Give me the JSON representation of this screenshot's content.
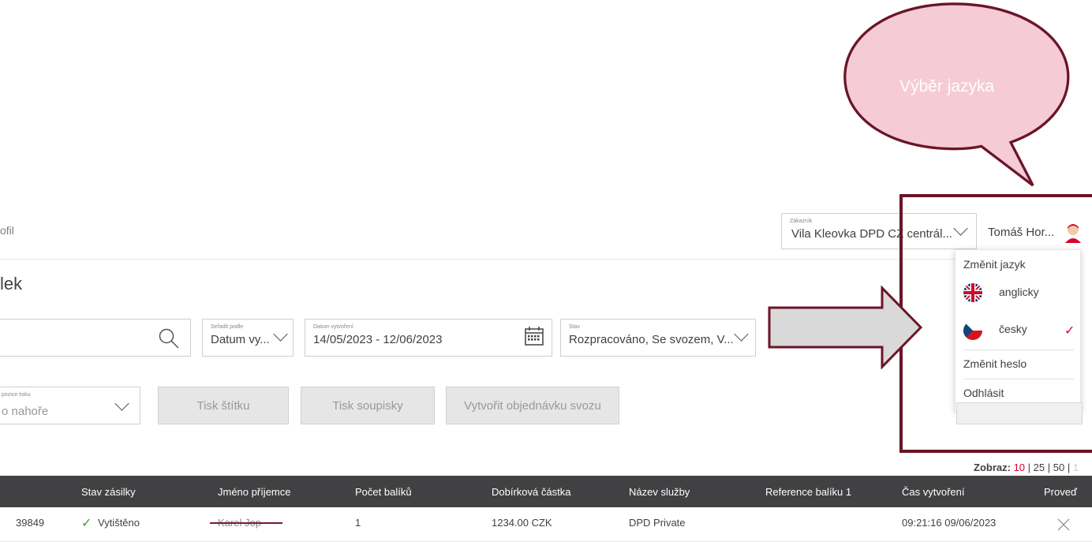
{
  "header": {
    "profile_text": "ofil",
    "customer": {
      "label": "Zákazník",
      "value": "Vila Kleovka DPD CZ centrál..."
    },
    "user_name": "Tomáš Hor..."
  },
  "user_menu": {
    "change_language": "Změnit jazyk",
    "languages": [
      {
        "label": "anglicky",
        "flag": "uk-flag-icon",
        "selected": false
      },
      {
        "label": "česky",
        "flag": "cz-flag-icon",
        "selected": true
      }
    ],
    "change_password": "Změnit heslo",
    "logout": "Odhlásit"
  },
  "page": {
    "title": "lek"
  },
  "filters": {
    "sort": {
      "label": "Seřadit podle",
      "value": "Datum vy..."
    },
    "date": {
      "label": "Datum vytvoření",
      "value": "14/05/2023 - 12/06/2023"
    },
    "state": {
      "label": "Stav",
      "value": "Rozpracováno, Se svozem, V..."
    },
    "print_position": {
      "label": "pozice tisku",
      "value": "o nahoře"
    }
  },
  "actions": {
    "print_label": "Tisk štítku",
    "print_list": "Tisk soupisky",
    "create_pickup": "Vytvořit objednávku svozu"
  },
  "pagination": {
    "label": "Zobraz:",
    "options": [
      "10",
      "25",
      "50",
      "1"
    ],
    "selected": "10"
  },
  "table": {
    "headers": [
      "Stav zásilky",
      "Jméno příjemce",
      "Počet balíků",
      "Dobírková částka",
      "Název služby",
      "Reference balíku 1",
      "Čas vytvoření",
      "Proveď"
    ],
    "rows": [
      {
        "id": "39849",
        "status": "Vytištěno",
        "recipient": "Karel Jop",
        "packages": "1",
        "cod": "1234.00 CZK",
        "service": "DPD Private",
        "reference": "",
        "created": "09:21:16 09/06/2023"
      }
    ]
  },
  "annotation": {
    "callout_text": "Výběr jazyka"
  },
  "colors": {
    "accent": "#dc0032",
    "annotation_border": "#6b1528",
    "callout_fill": "#f5cbd6",
    "table_header": "#414042"
  }
}
